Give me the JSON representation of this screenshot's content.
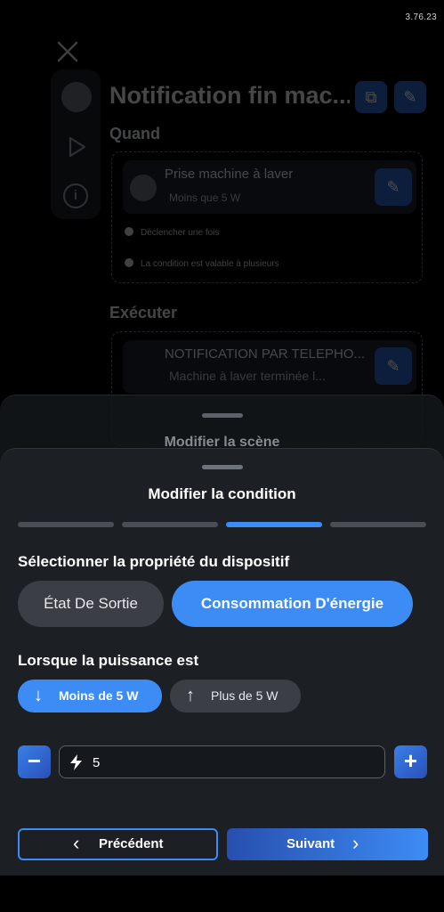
{
  "status": {
    "version": "3.76.23"
  },
  "background_scene": {
    "title": "Notification fin mac...",
    "when_label": "Quand",
    "trigger": {
      "device": "Prise machine à laver",
      "condition": "Moins que 5 W"
    },
    "options": [
      "Déclencher une fois",
      "La condition est valable à plusieurs"
    ],
    "execute_label": "Exécuter",
    "action": {
      "title": "NOTIFICATION PAR TELEPHO...",
      "message": "Machine à laver terminée l..."
    }
  },
  "middle_sheet": {
    "title": "Modifier la scène"
  },
  "condition_sheet": {
    "title": "Modifier la condition",
    "steps": {
      "count": 4,
      "active_index": 2
    },
    "property_label": "Sélectionner la propriété du dispositif",
    "property_options": [
      "État De Sortie",
      "Consommation D'énergie"
    ],
    "selected_property": "Consommation D'énergie",
    "power_label": "Lorsque la puissance est",
    "power_options": [
      {
        "label": "Moins de 5 W",
        "icon": "arrow-down-icon",
        "selected": true
      },
      {
        "label": "Plus de 5 W",
        "icon": "arrow-up-icon",
        "selected": false
      }
    ],
    "threshold": {
      "value": "5",
      "icon": "lightning-icon"
    },
    "previous_label": "Précédent",
    "next_label": "Suivant"
  },
  "colors": {
    "accent": "#3d8cf5",
    "sheet": "#1c1f24",
    "chip_off": "#3b3e44"
  }
}
